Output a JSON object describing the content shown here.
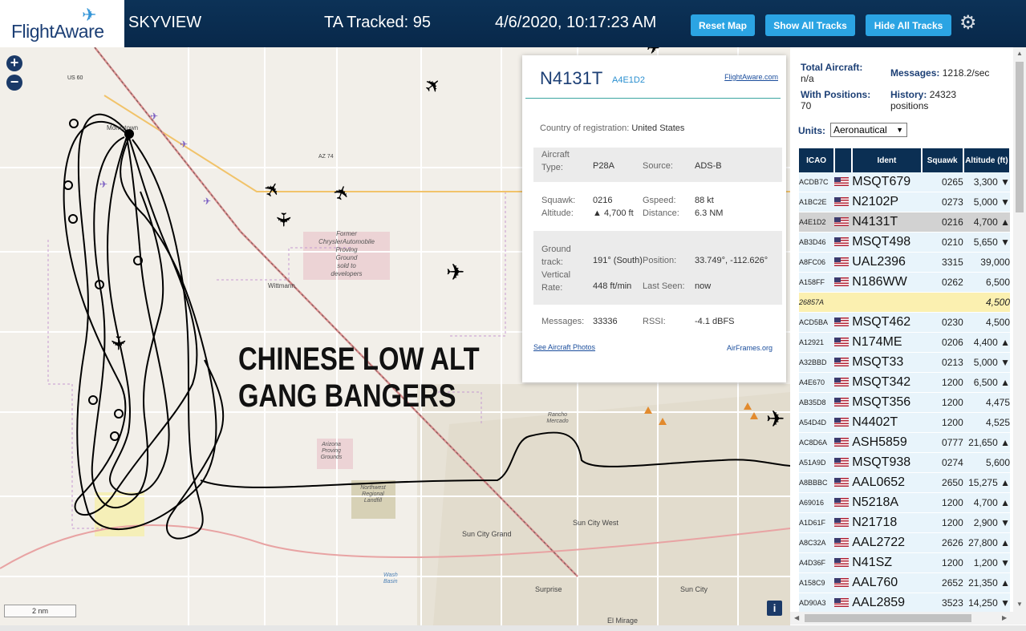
{
  "header": {
    "logo": "FlightAware",
    "title": "SKYVIEW",
    "tracked": "TA Tracked: 95",
    "time": "4/6/2020, 10:17:23 AM",
    "buttons": {
      "reset": "Reset Map",
      "show": "Show All Tracks",
      "hide": "Hide All Tracks"
    }
  },
  "map": {
    "banner_line1": "CHINESE LOW ALT",
    "banner_line2": "GANG BANGERS",
    "scale": "2 nm",
    "labels": {
      "us60": "US 60",
      "az74": "AZ 74",
      "morristown": "Morristown",
      "wittmann": "Wittmann",
      "former": "Former",
      "chrysler": "ChryslerAutomobile",
      "proving": "Proving",
      "ground": "Ground",
      "sold": "sold to",
      "devs": "developers",
      "rancho": "Rancho",
      "mercado": "Mercado",
      "arizona": "Arizona",
      "proving2": "Proving",
      "grounds2": "Grounds",
      "northwest": "Northwest",
      "regional": "Regional",
      "landfill": "Landfill",
      "suncitygrand": "Sun City Grand",
      "suncitywest": "Sun City West",
      "surprise": "Surprise",
      "suncity": "Sun City",
      "elmirage": "El Mirage",
      "wash": "Wash",
      "basin": "Basin"
    }
  },
  "popup": {
    "registration": "N4131T",
    "hex": "A4E1D2",
    "fa_link": "FlightAware.com",
    "country_label": "Country of registration:",
    "country": "United States",
    "aircraft_type_label1": "Aircraft",
    "aircraft_type_label2": "Type:",
    "aircraft_type": "P28A",
    "source_label": "Source:",
    "source": "ADS-B",
    "squawk_label": "Squawk:",
    "squawk": "0216",
    "gspeed_label": "Gspeed:",
    "gspeed": "88 kt",
    "altitude_label": "Altitude:",
    "altitude": "▲ 4,700 ft",
    "distance_label": "Distance:",
    "distance": "6.3 NM",
    "ground_label1": "Ground",
    "ground_label2": "track:",
    "track": "191° (South)",
    "position_label": "Position:",
    "position": "33.749°, -112.626°",
    "vertical_label1": "Vertical",
    "vertical_label2": "Rate:",
    "vertical": "448 ft/min",
    "lastseen_label": "Last Seen:",
    "lastseen": "now",
    "messages_label": "Messages:",
    "messages": "33336",
    "rssi_label": "RSSI:",
    "rssi": "-4.1 dBFS",
    "photos_link": "See Aircraft Photos",
    "airframes": "AirFrames.org"
  },
  "stats": {
    "total_label": "Total Aircraft:",
    "total": "n/a",
    "messages_label": "Messages:",
    "messages": "1218.2/sec",
    "positions_label": "With Positions:",
    "positions": "70",
    "history_label": "History:",
    "history": "24323",
    "history_unit": "positions"
  },
  "units": {
    "label": "Units:",
    "value": "Aeronautical"
  },
  "table": {
    "headers": [
      "ICAO",
      "Ident",
      "Squawk",
      "Altitude (ft)"
    ],
    "rows": [
      {
        "icao": "ACDB7C",
        "ident": "MSQT679",
        "squawk": "0265",
        "alt": "3,300 ▼"
      },
      {
        "icao": "A1BC2E",
        "ident": "N2102P",
        "squawk": "0273",
        "alt": "5,000 ▼"
      },
      {
        "icao": "A4E1D2",
        "ident": "N4131T",
        "squawk": "0216",
        "alt": "4,700 ▲"
      },
      {
        "icao": "AB3D46",
        "ident": "MSQT498",
        "squawk": "0210",
        "alt": "5,650 ▼"
      },
      {
        "icao": "A8FC06",
        "ident": "UAL2396",
        "squawk": "3315",
        "alt": "39,000"
      },
      {
        "icao": "A158FF",
        "ident": "N186WW",
        "squawk": "0262",
        "alt": "6,500"
      },
      {
        "icao": "26857A",
        "ident": "",
        "squawk": "",
        "alt": "4,500"
      },
      {
        "icao": "ACD5BA",
        "ident": "MSQT462",
        "squawk": "0230",
        "alt": "4,500"
      },
      {
        "icao": "A12921",
        "ident": "N174ME",
        "squawk": "0206",
        "alt": "4,400 ▲"
      },
      {
        "icao": "A32BBD",
        "ident": "MSQT33",
        "squawk": "0213",
        "alt": "5,000 ▼"
      },
      {
        "icao": "A4E670",
        "ident": "MSQT342",
        "squawk": "1200",
        "alt": "6,500 ▲"
      },
      {
        "icao": "AB35D8",
        "ident": "MSQT356",
        "squawk": "1200",
        "alt": "4,475"
      },
      {
        "icao": "A54D4D",
        "ident": "N4402T",
        "squawk": "1200",
        "alt": "4,525"
      },
      {
        "icao": "AC8D6A",
        "ident": "ASH5859",
        "squawk": "0777",
        "alt": "21,650 ▲"
      },
      {
        "icao": "A51A9D",
        "ident": "MSQT938",
        "squawk": "0274",
        "alt": "5,600"
      },
      {
        "icao": "A8BBBC",
        "ident": "AAL0652",
        "squawk": "2650",
        "alt": "15,275 ▲"
      },
      {
        "icao": "A69016",
        "ident": "N5218A",
        "squawk": "1200",
        "alt": "4,700 ▲"
      },
      {
        "icao": "A1D61F",
        "ident": "N21718",
        "squawk": "1200",
        "alt": "2,900 ▼"
      },
      {
        "icao": "A8C32A",
        "ident": "AAL2722",
        "squawk": "2626",
        "alt": "27,800 ▲"
      },
      {
        "icao": "A4D36F",
        "ident": "N41SZ",
        "squawk": "1200",
        "alt": "1,200 ▼"
      },
      {
        "icao": "A158C9",
        "ident": "AAL760",
        "squawk": "2652",
        "alt": "21,350 ▲"
      },
      {
        "icao": "AD90A3",
        "ident": "AAL2859",
        "squawk": "3523",
        "alt": "14,250 ▼"
      }
    ]
  }
}
